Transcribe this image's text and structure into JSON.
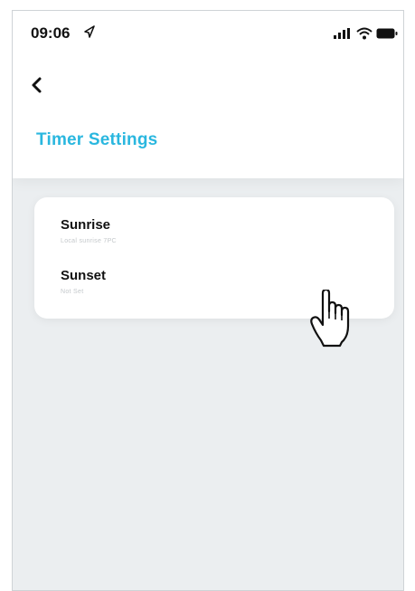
{
  "status_bar": {
    "time": "09:06",
    "icons": [
      "location-arrow-icon",
      "signal-icon",
      "wifi-icon",
      "battery-icon"
    ]
  },
  "header": {
    "back_icon": "chevron-left-icon",
    "title": "Timer Settings"
  },
  "timers": [
    {
      "label": "Sunrise",
      "sub": "Local sunrise 7PC"
    },
    {
      "label": "Sunset",
      "sub": "Not Set"
    }
  ],
  "colors": {
    "accent": "#2ab7df",
    "background": "#ebeef0",
    "card": "#ffffff"
  },
  "cursor": "hand-pointer-icon"
}
